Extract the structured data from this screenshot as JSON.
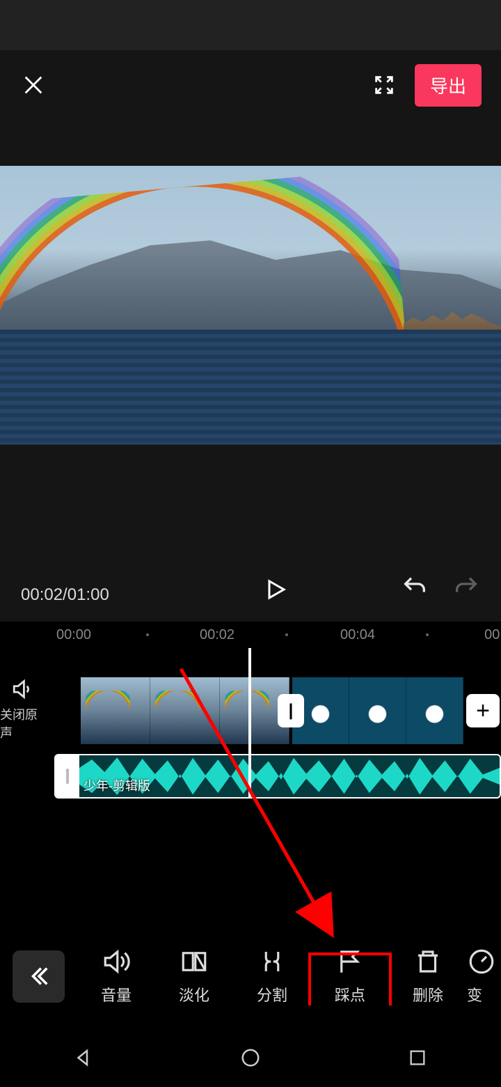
{
  "header": {
    "export_label": "导出"
  },
  "playback": {
    "current_time": "00:02",
    "total_time": "01:00",
    "time_display": "00:02/01:00"
  },
  "ruler": {
    "ticks": [
      "00:00",
      "00:02",
      "00:04",
      "00:"
    ]
  },
  "mute": {
    "label": "关闭原声"
  },
  "audio": {
    "clip_name": "少年-剪辑版"
  },
  "toolbar": {
    "items": [
      {
        "id": "volume",
        "label": "音量"
      },
      {
        "id": "fade",
        "label": "淡化"
      },
      {
        "id": "split",
        "label": "分割"
      },
      {
        "id": "beat",
        "label": "踩点"
      },
      {
        "id": "delete",
        "label": "删除"
      },
      {
        "id": "speed",
        "label": "变"
      }
    ],
    "highlighted": "beat"
  },
  "transition_glyph": "|",
  "add_glyph": "+"
}
